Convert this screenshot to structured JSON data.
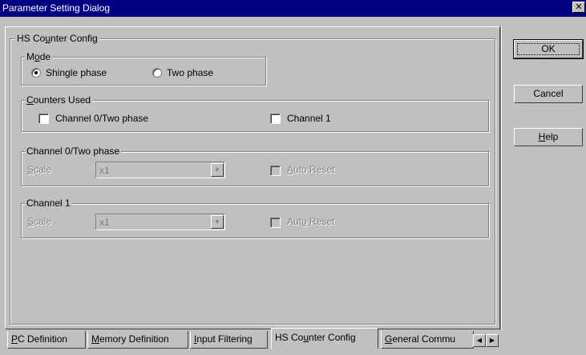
{
  "window": {
    "title": "Parameter Setting Dialog",
    "close_glyph": "✕"
  },
  "tabs": [
    {
      "label": "PC Definition",
      "accel": "P",
      "rest": "C Definition"
    },
    {
      "label": "Memory Definition",
      "accel": "M",
      "rest": "emory Definition"
    },
    {
      "label": "Input Filtering",
      "accel": "I",
      "rest": "nput Filtering"
    },
    {
      "label": "HS Counter Config",
      "pre": "HS Co",
      "accel": "u",
      "rest": "nter Config"
    },
    {
      "label": "General Commu",
      "accel": "G",
      "rest": "eneral Commu"
    }
  ],
  "active_tab": "HS Counter Config",
  "panel": {
    "title_pre": "HS Co",
    "title_accel": "u",
    "title_rest": "nter Config",
    "mode": {
      "title_pre": "M",
      "title_accel": "o",
      "title_rest": "de",
      "options": [
        "Shingle phase",
        "Two phase"
      ],
      "selected": "Shingle phase"
    },
    "counters_used": {
      "title_accel": "C",
      "title_rest": "ounters Used",
      "channel0_label": "Channel 0/Two phase",
      "channel0_checked": false,
      "channel1_label": "Channel 1",
      "channel1_checked": false
    },
    "channel0": {
      "title": "Channel 0/Two phase",
      "scale_accel": "S",
      "scale_rest": "cale",
      "scale_value": "x1",
      "auto_reset_accel": "A",
      "auto_reset_rest": "uto Reset"
    },
    "channel1": {
      "title": "Channel 1",
      "scale_accel": "S",
      "scale_rest": "cale",
      "scale_value": "x1",
      "auto_reset_pre": "Aut",
      "auto_reset_accel": "o",
      "auto_reset_rest": " Reset"
    }
  },
  "buttons": {
    "ok": "OK",
    "cancel": "Cancel",
    "help_accel": "H",
    "help_rest": "elp"
  }
}
